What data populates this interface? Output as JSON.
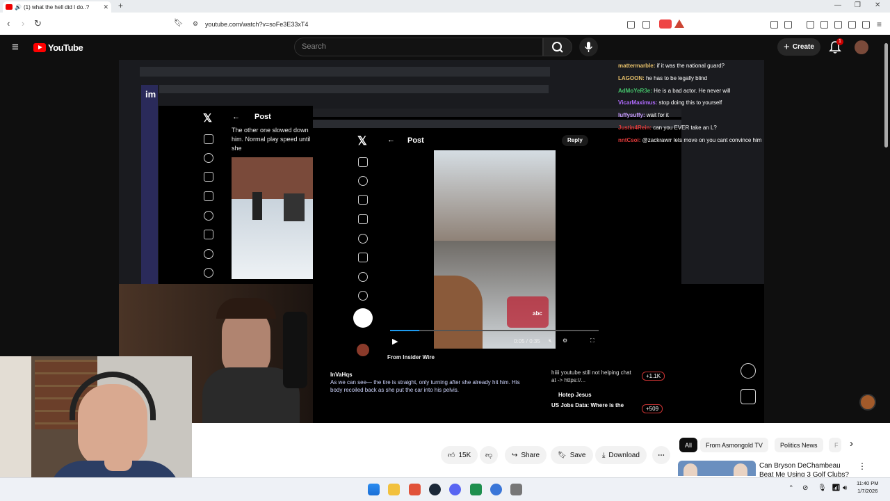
{
  "browser": {
    "tab_title": "(1) what the hell did I do..?",
    "new_tab": "+",
    "url": "youtube.com/watch?v=soFe3E33xT4"
  },
  "youtube": {
    "logo_text": "YouTube",
    "search_placeholder": "Search",
    "create_label": "Create",
    "notification_count": "1"
  },
  "video": {
    "tweet_left": {
      "header": "Post",
      "text": "The other one slowed down him. Normal play speed until she"
    },
    "tweet_center": {
      "header": "Post",
      "reply": "Reply",
      "video_time": "0:05 / 0:35",
      "source": "From Insider Wire",
      "comment_user": "InVaHqs",
      "comment_text": "As we can see— the tire is straight, only turning after she already hit him. His body recoiled back as she put the car into his pelvis.",
      "news_logo": "abc",
      "side_snippet_1": "hiiii youtube still not helping chat at -> https://...",
      "side_snippet_2": "Hotep Jesus",
      "side_snippet_3": "US Jobs Data: Where is the",
      "badge_1": "+1.1K",
      "badge_2": "+509"
    },
    "chat": [
      {
        "user": "mattermarble:",
        "msg": "if it was the national guard?",
        "color": "#e8c16a"
      },
      {
        "user": "LAGOON:",
        "msg": "he has to be legally blind",
        "color": "#e8c16a"
      },
      {
        "user": "AdMoYeR3e:",
        "msg": "He is a bad actor. He never will",
        "color": "#45c36b"
      },
      {
        "user": "VicarMaximus:",
        "msg": "stop doing this to yourself",
        "color": "#b06bff"
      },
      {
        "user": "luffysuffy:",
        "msg": "wait for it",
        "color": "#c79bff"
      },
      {
        "user": "Justin4Rein:",
        "msg": "can you EVER take an L?",
        "color": "#e23b3b"
      },
      {
        "user": "nntCsoi:",
        "msg": "@zackrawrr lets move on you cant convince him",
        "color": "#e23b3b"
      }
    ]
  },
  "actions": {
    "like_count": "15K",
    "share": "Share",
    "save": "Save",
    "download": "Download"
  },
  "chips": [
    "All",
    "From Asmongold TV",
    "Politics News",
    "F"
  ],
  "recommendation": {
    "title": "Can Bryson DeChambeau Beat Me Using 3 Golf Clubs?"
  },
  "taskbar": {
    "time": "11:40 PM",
    "date": "1/7/2026"
  }
}
